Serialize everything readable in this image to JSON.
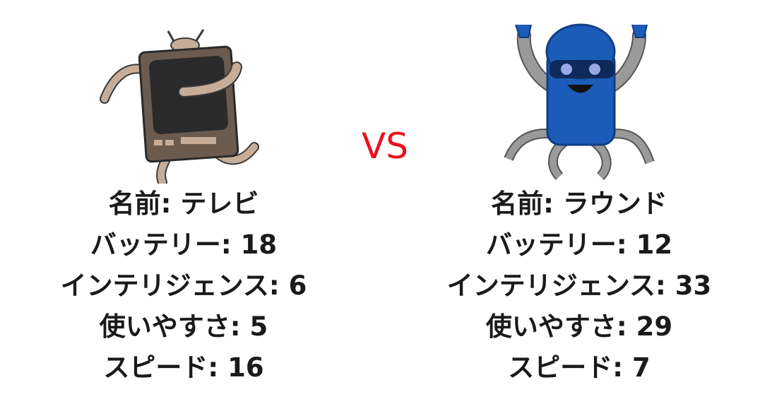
{
  "vs_label": "VS",
  "colors": {
    "vs": "#e8111c",
    "text": "#1a1a1a",
    "tv_body": "#6b5a4e",
    "tv_screen": "#2a2a2a",
    "tv_limbs": "#c7ad98",
    "round_body": "#1a5cb8",
    "round_limbs": "#9a9a9a"
  },
  "left": {
    "icon": "tv-robot-icon",
    "stats": [
      {
        "label": "名前",
        "value": "テレビ",
        "text": "名前: テレビ"
      },
      {
        "label": "バッテリー",
        "value": "18",
        "text": "バッテリー: 18"
      },
      {
        "label": "インテリジェンス",
        "value": "6",
        "text": "インテリジェンス: 6"
      },
      {
        "label": "使いやすさ",
        "value": "5",
        "text": "使いやすさ: 5"
      },
      {
        "label": "スピード",
        "value": "16",
        "text": "スピード: 16"
      }
    ]
  },
  "right": {
    "icon": "round-robot-icon",
    "stats": [
      {
        "label": "名前",
        "value": "ラウンド",
        "text": "名前: ラウンド"
      },
      {
        "label": "バッテリー",
        "value": "12",
        "text": "バッテリー: 12"
      },
      {
        "label": "インテリジェンス",
        "value": "33",
        "text": "インテリジェンス: 33"
      },
      {
        "label": "使いやすさ",
        "value": "29",
        "text": "使いやすさ: 29"
      },
      {
        "label": "スピード",
        "value": "7",
        "text": "スピード: 7"
      }
    ]
  }
}
